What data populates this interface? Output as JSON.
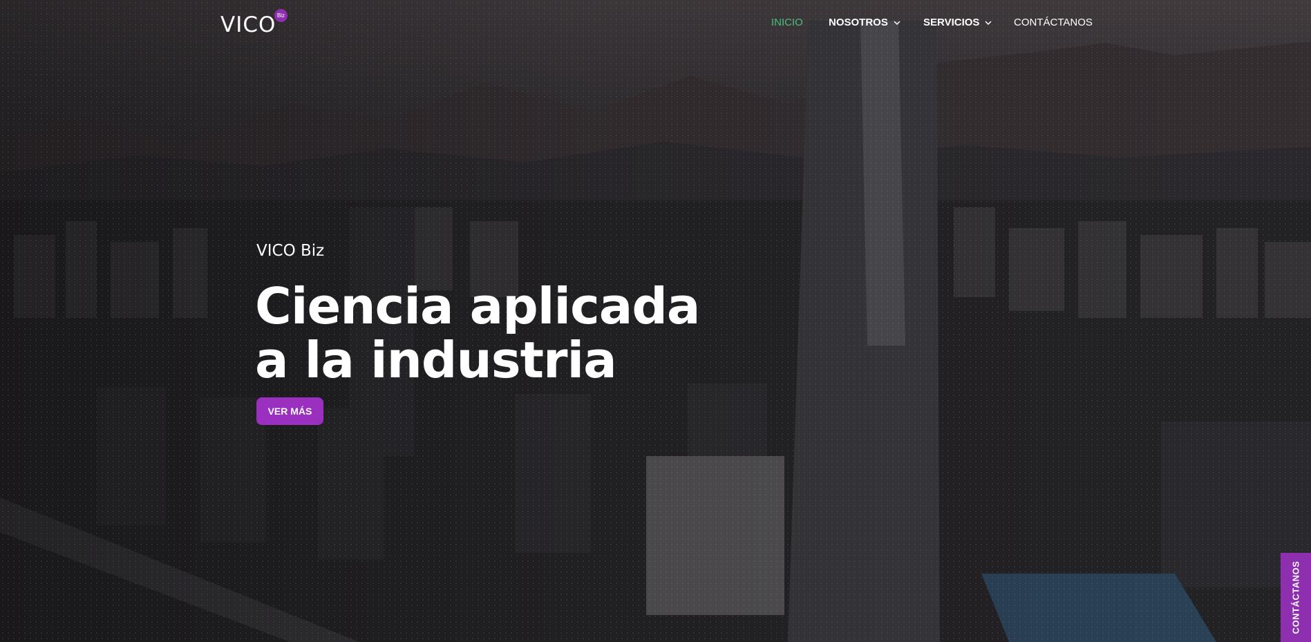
{
  "brand": {
    "name": "VICO",
    "badge": "Biz"
  },
  "nav": {
    "items": [
      {
        "label": "INICIO",
        "active": true,
        "has_dropdown": false
      },
      {
        "label": "NOSOTROS",
        "active": false,
        "has_dropdown": true
      },
      {
        "label": "SERVICIOS",
        "active": false,
        "has_dropdown": true
      },
      {
        "label": "CONTÁCTANOS",
        "active": false,
        "has_dropdown": false
      }
    ]
  },
  "hero": {
    "eyebrow": "VICO Biz",
    "headline_line1": "Ciencia aplicada",
    "headline_line2": "a la industria",
    "cta_label": "VER MÁS"
  },
  "side_tab": {
    "label": "CONTÁCTANOS"
  },
  "colors": {
    "accent": "#9a2fc0",
    "active_nav": "#4bc07e",
    "text": "#ffffff"
  }
}
